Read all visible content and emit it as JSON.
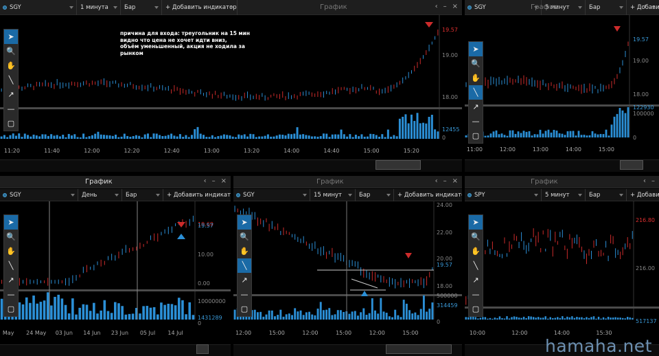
{
  "colors": {
    "up": "#2b8fd6",
    "down": "#cc2b2b",
    "bg": "#000000",
    "panel_bar": "#1e1e1e",
    "active_tool": "#1a6aa6",
    "price_red": "#e03030",
    "price_blue": "#3a9ad9"
  },
  "tools": [
    {
      "name": "pointer-tool-icon",
      "glyph": "➤"
    },
    {
      "name": "zoom-tool-icon",
      "glyph": "🔍"
    },
    {
      "name": "hand-tool-icon",
      "glyph": "✋"
    },
    {
      "name": "line-tool-icon",
      "glyph": "╲"
    },
    {
      "name": "arrow-tool-icon",
      "glyph": "↗"
    },
    {
      "name": "horizontal-line-tool-icon",
      "glyph": "—"
    },
    {
      "name": "rectangle-tool-icon",
      "glyph": "▢"
    }
  ],
  "panels": [
    {
      "id": "p1",
      "title": "График",
      "symbol": "SGY",
      "timeframe": "1 минута",
      "chart_type": "Бар",
      "add_indicator": "+ Добавить индикатор",
      "buttons": [
        "‹",
        "–",
        "×"
      ],
      "annotation": [
        "причина для входа: треугольник на 15 мин",
        "видно что цена не хочет идти вниз,",
        "объём уменьшенный, акция не ходила за",
        "рынком"
      ],
      "price_labels": [
        {
          "text": "19.57",
          "color": "red"
        },
        {
          "text": "19.00",
          "color": "gray"
        },
        {
          "text": "18.00",
          "color": "gray"
        }
      ],
      "volume_labels": [
        {
          "text": "12455",
          "color": "blue"
        },
        {
          "text": "0",
          "color": "gray"
        }
      ],
      "time_labels": [
        "11:20",
        "11:40",
        "12:00",
        "12:20",
        "12:40",
        "13:00",
        "13:20",
        "14:00",
        "14:40",
        "15:00",
        "15:20"
      ]
    },
    {
      "id": "p2",
      "title": "График",
      "symbol": "SGY",
      "timeframe": "5 минут",
      "chart_type": "Бар",
      "add_indicator": "+ Добавить",
      "buttons": [
        "‹",
        "–"
      ],
      "price_labels": [
        {
          "text": "19.57",
          "color": "blue"
        },
        {
          "text": "19.00",
          "color": "gray"
        },
        {
          "text": "18.00",
          "color": "gray"
        }
      ],
      "volume_labels": [
        {
          "text": "122930",
          "color": "blue"
        },
        {
          "text": "100000",
          "color": "gray"
        },
        {
          "text": "0",
          "color": "gray"
        }
      ],
      "time_labels": [
        "11:00",
        "12:00",
        "13:00",
        "14:00",
        "15:00"
      ]
    },
    {
      "id": "p3",
      "title": "График",
      "symbol": "SGY",
      "timeframe": "День",
      "chart_type": "Бар",
      "add_indicator": "+ Добавить индикатор",
      "buttons": [
        "‹",
        "–",
        "×"
      ],
      "price_labels": [
        {
          "text": "19.69",
          "color": "red"
        },
        {
          "text": "19.57",
          "color": "blue"
        },
        {
          "text": "10.00",
          "color": "gray"
        },
        {
          "text": "0.00",
          "color": "gray"
        }
      ],
      "volume_labels": [
        {
          "text": "10000000",
          "color": "gray"
        },
        {
          "text": "1431289",
          "color": "blue"
        },
        {
          "text": "0",
          "color": "gray"
        }
      ],
      "time_labels": [
        "May",
        "24 May",
        "03 Jun",
        "14 Jun",
        "23 Jun",
        "05 Jul",
        "14 Jul"
      ]
    },
    {
      "id": "p4",
      "title": "График",
      "symbol": "SGY",
      "timeframe": "15 минут",
      "chart_type": "Бар",
      "add_indicator": "+ Добавить индикатор",
      "buttons": [
        "‹",
        "–",
        "×"
      ],
      "price_labels": [
        {
          "text": "24.00",
          "color": "gray"
        },
        {
          "text": "22.00",
          "color": "gray"
        },
        {
          "text": "20.00",
          "color": "gray"
        },
        {
          "text": "19.57",
          "color": "blue"
        },
        {
          "text": "18.00",
          "color": "gray"
        }
      ],
      "volume_labels": [
        {
          "text": "500000",
          "color": "gray"
        },
        {
          "text": "314459",
          "color": "blue"
        },
        {
          "text": "0",
          "color": "gray"
        }
      ],
      "time_labels": [
        "12:00",
        "15:00",
        "12:00",
        "15:00",
        "12:00",
        "15:00"
      ]
    },
    {
      "id": "p5",
      "title": "График",
      "symbol": "SPY",
      "timeframe": "5 минут",
      "chart_type": "Бар",
      "add_indicator": "+ Добавить",
      "buttons": [
        "‹",
        "–"
      ],
      "price_labels": [
        {
          "text": "216.80",
          "color": "red"
        },
        {
          "text": "216.00",
          "color": "gray"
        }
      ],
      "volume_labels": [
        {
          "text": "517137",
          "color": "blue"
        }
      ],
      "time_labels": [
        "10:00",
        "12:00",
        "14:00",
        "15:30"
      ]
    }
  ],
  "watermark": "hamaha.net"
}
